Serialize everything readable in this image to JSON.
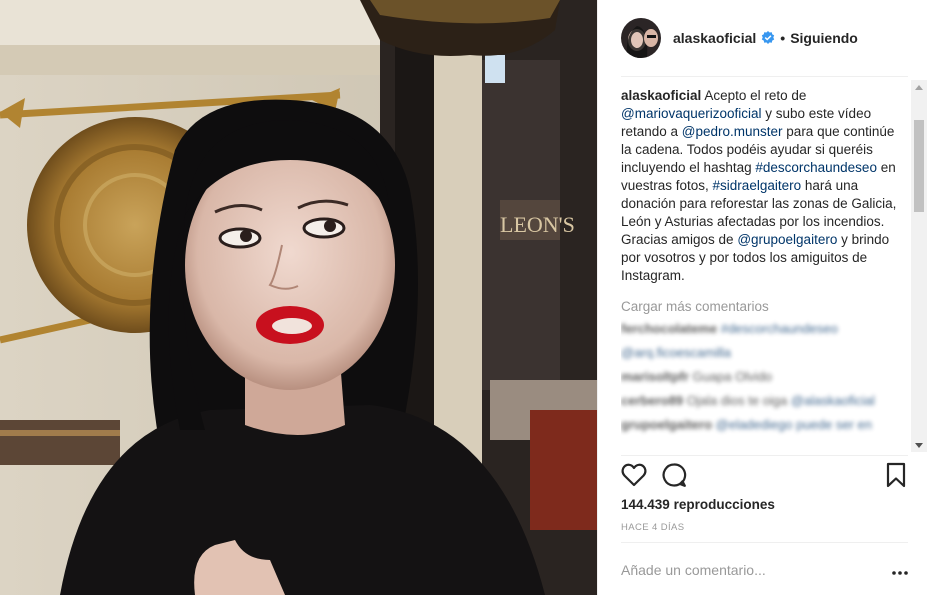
{
  "post": {
    "username": "alaskaoficial",
    "dot": "•",
    "follow_status": "Siguiendo"
  },
  "caption": {
    "username": "alaskaoficial",
    "t1": " Acepto el reto de ",
    "m1": "@mariovaquerizooficial",
    "t2": " y subo este vídeo retando a ",
    "m2": "@pedro.munster",
    "t3": " para que continúe la cadena. Todos podéis ayudar si queréis incluyendo el hashtag ",
    "h1": "#descorchaundeseo",
    "t4": " en vuestras fotos, ",
    "h2": "#sidraelgaitero",
    "t5": " hará una donación para reforestar las zonas de Galicia, León y Asturias afectadas por los incendios. Gracias amigos de ",
    "m3": "@grupoelgaitero",
    "t6": " y brindo por vosotros y por todos los amiguitos de Instagram."
  },
  "load_more": "Cargar más comentarios",
  "comments": [
    {
      "user": "ferchocolateme",
      "text": "",
      "link": "#descorchaundeseo"
    },
    {
      "user": "",
      "text": "",
      "link": "@arq.ficoescamilla"
    },
    {
      "user": "marisoltpfr",
      "text": "Guapa Olvido",
      "link": ""
    },
    {
      "user": "cerbero89",
      "text": "Ojala dios te oiga ",
      "link": "@alaskaoficial"
    },
    {
      "user": "grupoelgaitero",
      "text": "",
      "link": "@eladediego puede ser en"
    }
  ],
  "views": {
    "count": "144.439",
    "label": " reproducciones"
  },
  "time_ago": "HACE 4 DÍAS",
  "add_comment_placeholder": "Añade un comentario...",
  "icons": [
    "verified-badge-icon",
    "heart-icon",
    "comment-icon",
    "bookmark-icon",
    "more-options-icon"
  ],
  "colors": {
    "link": "#003569",
    "muted": "#999999",
    "verified": "#3897f0",
    "text": "#262626"
  }
}
